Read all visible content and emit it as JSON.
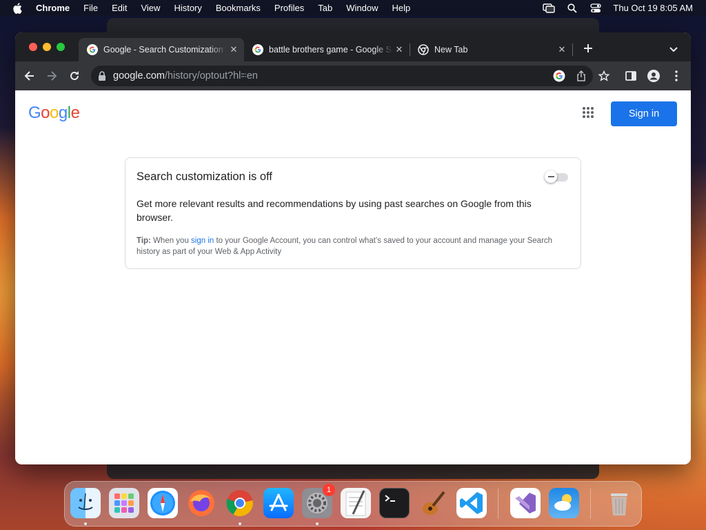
{
  "menubar": {
    "app_name": "Chrome",
    "items": [
      "File",
      "Edit",
      "View",
      "History",
      "Bookmarks",
      "Profiles",
      "Tab",
      "Window",
      "Help"
    ],
    "clock": "Thu Oct 19  8:05 AM"
  },
  "tabs": [
    {
      "title": "Google - Search Customization",
      "active": true
    },
    {
      "title": "battle brothers game - Google Search",
      "active": false
    },
    {
      "title": "New Tab",
      "active": false
    }
  ],
  "omnibox": {
    "host": "google.com",
    "path": "/history/optout?hl=en"
  },
  "page": {
    "logo_text": "Google",
    "sign_in_label": "Sign in",
    "card": {
      "title": "Search customization is off",
      "toggle_on": false,
      "description": "Get more relevant results and recommendations by using past searches on Google from this browser.",
      "tip_label": "Tip:",
      "tip_before": " When you ",
      "tip_link": "sign in",
      "tip_after": " to your Google Account, you can control what’s saved to your account and manage your Search history as part of your Web & App Activity"
    }
  },
  "dock": {
    "apps": [
      "finder",
      "launchpad",
      "safari",
      "firefox",
      "chrome",
      "app-store",
      "system-settings",
      "textedit",
      "terminal",
      "garageband",
      "vscode",
      "visual-studio",
      "weather",
      "trash"
    ],
    "system_settings_badge": "1"
  },
  "colors": {
    "accent": "#1a73e8",
    "tab_bar": "#202124",
    "toolbar": "#35363a"
  }
}
